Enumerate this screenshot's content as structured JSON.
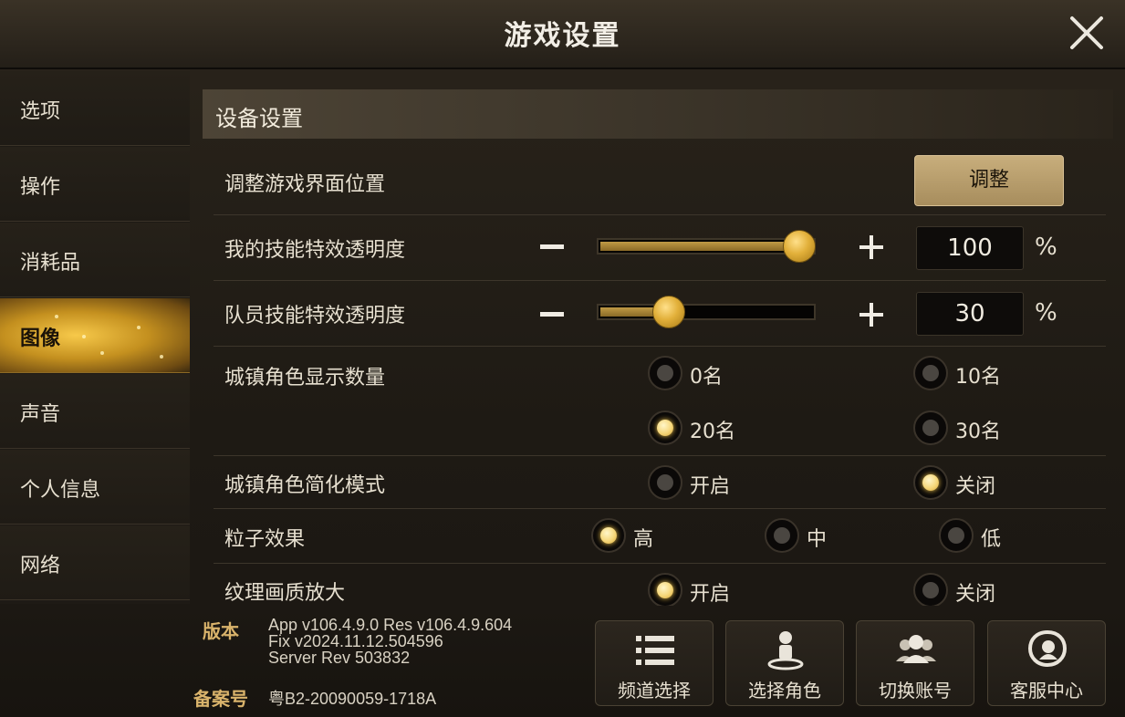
{
  "header": {
    "title": "游戏设置"
  },
  "sidebar": {
    "items": [
      {
        "label": "选项"
      },
      {
        "label": "操作"
      },
      {
        "label": "消耗品"
      },
      {
        "label": "图像",
        "active": true
      },
      {
        "label": "声音"
      },
      {
        "label": "个人信息"
      },
      {
        "label": "网络"
      }
    ]
  },
  "section": {
    "title": "设备设置"
  },
  "settings": {
    "ui_position": {
      "label": "调整游戏界面位置",
      "button": "调整"
    },
    "my_skill_opacity": {
      "label": "我的技能特效透明度",
      "value": "100",
      "unit": "%",
      "level": 1.0
    },
    "team_skill_opacity": {
      "label": "队员技能特效透明度",
      "value": "30",
      "unit": "%",
      "level": 0.3
    },
    "town_count": {
      "label": "城镇角色显示数量",
      "options": [
        "0名",
        "10名",
        "20名",
        "30名"
      ],
      "selected": "20名"
    },
    "town_simplify": {
      "label": "城镇角色简化模式",
      "options": [
        "开启",
        "关闭"
      ],
      "selected": "关闭"
    },
    "particles": {
      "label": "粒子效果",
      "options": [
        "高",
        "中",
        "低"
      ],
      "selected": "高"
    },
    "texture_upscale": {
      "label": "纹理画质放大",
      "options": [
        "开启",
        "关闭"
      ],
      "selected": "开启"
    }
  },
  "footer": {
    "version_label": "版本",
    "version_lines": [
      "App v106.4.9.0 Res v106.4.9.604",
      "Fix v2024.11.12.504596",
      "Server Rev 503832"
    ],
    "icp_label": "备案号",
    "icp_value": "粤B2-20090059-1718A",
    "buttons": [
      {
        "label": "频道选择",
        "icon": "list-icon"
      },
      {
        "label": "选择角色",
        "icon": "character-pin-icon"
      },
      {
        "label": "切换账号",
        "icon": "users-icon"
      },
      {
        "label": "客服中心",
        "icon": "support-icon"
      }
    ]
  },
  "colors": {
    "accent_gold": "#e2b03a",
    "button_gold": "#b79d6b",
    "panel_bg": "#1e1a14"
  }
}
